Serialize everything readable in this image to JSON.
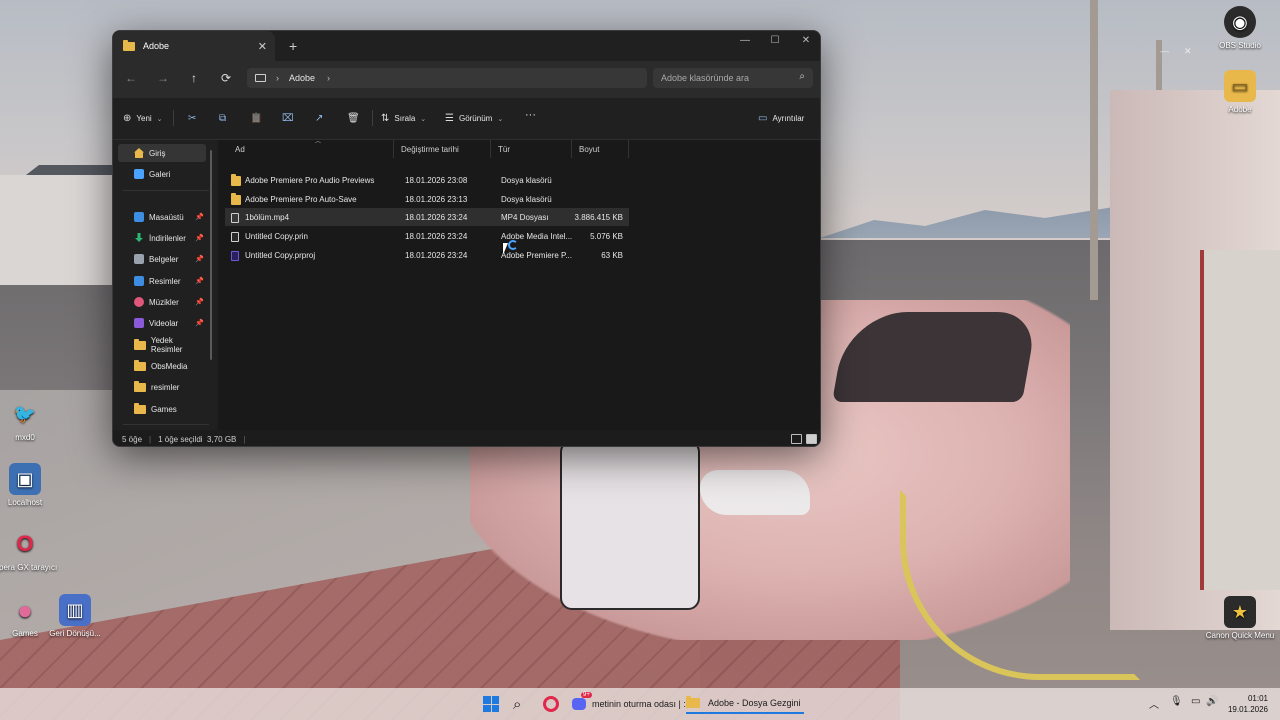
{
  "window": {
    "tab_title": "Adobe",
    "tab_close": "✕",
    "tab_add": "+",
    "controls": {
      "minimize": "—",
      "maximize": "☐",
      "close": "✕"
    }
  },
  "nav": {
    "back": "←",
    "forward": "→",
    "up": "↑",
    "refresh": "⟳",
    "breadcrumb_sep": "›",
    "breadcrumb": "Adobe",
    "search_placeholder": "Adobe klasöründe ara",
    "search_icon": "⌕"
  },
  "commandbar": {
    "new_label": "Yeni",
    "cut_icon": "✂",
    "copy_icon": "⧉",
    "paste_icon": "📋",
    "rename_icon": "⌧",
    "share_icon": "↗",
    "delete_icon": "🗑",
    "sort_label": "Sırala",
    "view_label": "Görünüm",
    "more": "···",
    "details_label": "Ayrıntılar"
  },
  "sidebar": {
    "items": [
      {
        "label": "Giriş",
        "icon": "home-icon",
        "color": "#e8b84a",
        "pinned": false
      },
      {
        "label": "Galeri",
        "icon": "gallery-icon",
        "color": "#4aa3ff",
        "pinned": false
      },
      {
        "label": "Masaüstü",
        "icon": "desktop-icon",
        "color": "#3d8ee0",
        "pinned": true
      },
      {
        "label": "İndirilenler",
        "icon": "download-icon",
        "color": "#2bb673",
        "pinned": true
      },
      {
        "label": "Belgeler",
        "icon": "documents-icon",
        "color": "#9aa3ad",
        "pinned": true
      },
      {
        "label": "Resimler",
        "icon": "pictures-icon",
        "color": "#3d8ee0",
        "pinned": true
      },
      {
        "label": "Müzikler",
        "icon": "music-icon",
        "color": "#e0577a",
        "pinned": true
      },
      {
        "label": "Videolar",
        "icon": "videos-icon",
        "color": "#8a5ad8",
        "pinned": true
      },
      {
        "label": "Yedek Resimler",
        "icon": "folder-icon",
        "color": "#e8b84a",
        "pinned": false
      },
      {
        "label": "ObsMedia",
        "icon": "folder-icon",
        "color": "#e8b84a",
        "pinned": false
      },
      {
        "label": "resimler",
        "icon": "folder-icon",
        "color": "#e8b84a",
        "pinned": false
      },
      {
        "label": "Games",
        "icon": "folder-icon",
        "color": "#e8b84a",
        "pinned": false
      }
    ],
    "pin_glyph": "📌"
  },
  "columns": {
    "name": "Ad",
    "modified": "Değiştirme tarihi",
    "type": "Tür",
    "size": "Boyut"
  },
  "files": [
    {
      "name": "Adobe Premiere Pro Audio Previews",
      "modified": "18.01.2026 23:08",
      "type": "Dosya klasörü",
      "size": "",
      "kind": "folder",
      "selected": false
    },
    {
      "name": "Adobe Premiere Pro Auto-Save",
      "modified": "18.01.2026 23:13",
      "type": "Dosya klasörü",
      "size": "",
      "kind": "folder",
      "selected": false
    },
    {
      "name": "1bölüm.mp4",
      "modified": "18.01.2026 23:24",
      "type": "MP4 Dosyası",
      "size": "3.886.415 KB",
      "kind": "mp4",
      "selected": true
    },
    {
      "name": "Untitled Copy.prin",
      "modified": "18.01.2026 23:24",
      "type": "Adobe Media Intel...",
      "size": "5.076 KB",
      "kind": "doc",
      "selected": false
    },
    {
      "name": "Untitled Copy.prproj",
      "modified": "18.01.2026 23:24",
      "type": "Adobe Premiere P...",
      "size": "63 KB",
      "kind": "prproj",
      "selected": false
    }
  ],
  "status": {
    "count": "5 öğe",
    "selected": "1 öğe seçildi  3,70 GB"
  },
  "desktop": [
    {
      "label": "OBS Studio",
      "glyph": "◉",
      "bg": "#2b2b2b",
      "fg": "#ffffff"
    },
    {
      "label": "Adobe",
      "glyph": "▭",
      "bg": "#e8b84a",
      "fg": "#8a6520"
    },
    {
      "label": "mxd0",
      "glyph": "🐦",
      "bg": "transparent",
      "fg": "#ffffff"
    },
    {
      "label": "Localhost",
      "glyph": "▣",
      "bg": "#3d6fb3",
      "fg": "#ffffff"
    },
    {
      "label": "Opera GX tarayıcı",
      "glyph": "O",
      "bg": "transparent",
      "fg": "#e0284a"
    },
    {
      "label": "Games",
      "glyph": "●",
      "bg": "transparent",
      "fg": "#e06a9a"
    },
    {
      "label": "Geri Dönüşü...",
      "glyph": "▥",
      "bg": "#4a6fc7",
      "fg": "#ffffff"
    },
    {
      "label": "Canon Quick Menu",
      "glyph": "★",
      "bg": "#2b2b2b",
      "fg": "#f0c040"
    }
  ],
  "taskbar": {
    "search_icon": "⌕",
    "discord_badge": "9+",
    "discord_label": "metinin oturma odası | :",
    "explorer_label": "Adobe - Dosya Gezgini",
    "tray": {
      "chevron": "︿",
      "mic": "🎙",
      "monitor": "▭",
      "volume": "🔊"
    },
    "time": "01:01",
    "date": "19.01.2026"
  }
}
